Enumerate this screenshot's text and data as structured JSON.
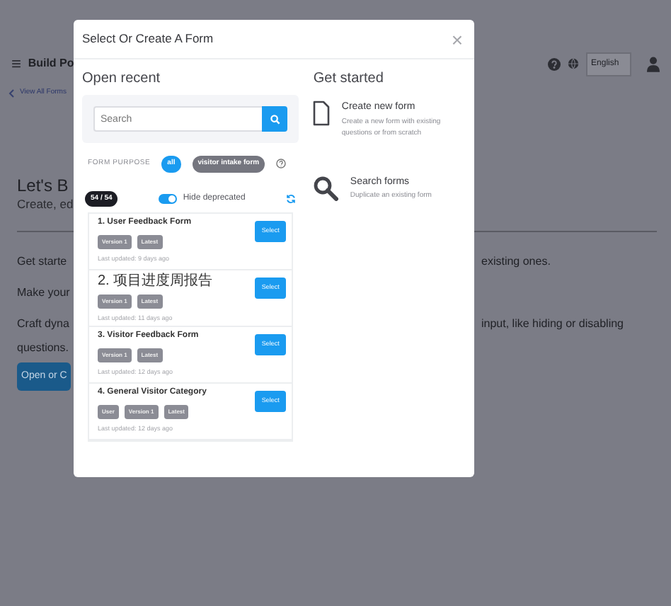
{
  "page": {
    "menu_icon": "≡",
    "app_title": "Build Po",
    "language": "English",
    "back_link": "View All Forms",
    "heading": "Let's B",
    "subheading": "Create, ed",
    "paragraphs_left": [
      "Get starte",
      "Make your",
      "Craft dyna",
      "questions."
    ],
    "paragraphs_right": [
      "existing ones.",
      "input, like hiding or disabling"
    ],
    "button": "Open or C"
  },
  "modal": {
    "title": "Select Or Create A Form",
    "close": "×",
    "open_recent": {
      "heading": "Open recent",
      "search": {
        "placeholder": "Search"
      },
      "form_purpose_label": "FORM PURPOSE",
      "purposes": [
        {
          "label": "all",
          "selected": true
        },
        {
          "label": "visitor intake form",
          "selected": false
        }
      ],
      "count": "54 / 54",
      "hide_deprecated": {
        "label": "Hide deprecated",
        "on": true
      },
      "forms": [
        {
          "title": "1. User Feedback Form",
          "select": "Select",
          "badges": [
            "Version 1",
            "Latest"
          ],
          "updated": "Last updated: 9 days ago"
        },
        {
          "title": "2. 项目进度周报告",
          "select": "Select",
          "badges": [
            "Version 1",
            "Latest"
          ],
          "updated": "Last updated: 11 days ago"
        },
        {
          "title": "3. Visitor Feedback Form",
          "select": "Select",
          "badges": [
            "Version 1",
            "Latest"
          ],
          "updated": "Last updated: 12 days ago"
        },
        {
          "title": "4. General Visitor Category",
          "select": "Select",
          "badges": [
            "User",
            "Version 1",
            "Latest"
          ],
          "updated": "Last updated: 12 days ago"
        }
      ]
    },
    "get_started": {
      "heading": "Get started",
      "options": [
        {
          "kind": "create",
          "title": "Create new form",
          "description": "Create a new form with existing questions or from scratch"
        },
        {
          "kind": "search",
          "title": "Search forms",
          "description": "Duplicate an existing form"
        }
      ]
    }
  }
}
